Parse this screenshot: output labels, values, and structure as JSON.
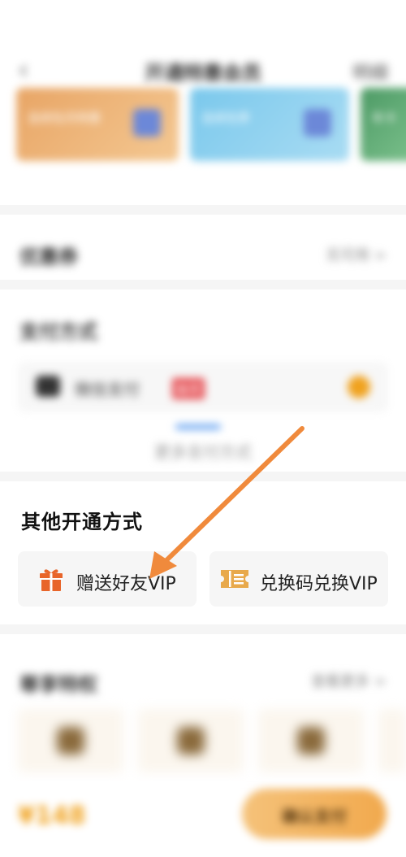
{
  "header": {
    "back_glyph": "‹",
    "title": "开通特惠会员",
    "right_label": "明细"
  },
  "plans": [
    {
      "text": "连续包月特惠"
    },
    {
      "text": "连续包季"
    },
    {
      "text": "年卡"
    }
  ],
  "coupon": {
    "label": "优惠券",
    "right_text": "无可用 >"
  },
  "payment": {
    "label": "支付方式",
    "method": "微信支付",
    "badge": "推荐",
    "more": "更多支付方式"
  },
  "other_methods": {
    "title": "其他开通方式",
    "gift_label": "赠送好友VIP",
    "redeem_label": "兑换码兑换VIP"
  },
  "privileges": {
    "label": "尊享特权",
    "right_text": "查看更多 >"
  },
  "bottom": {
    "price": "¥148",
    "button": "确认支付"
  },
  "colors": {
    "accent": "#f0a21e",
    "gift_icon": "#e8652a",
    "code_icon": "#e8a94b",
    "annotation_arrow": "#f08a3c"
  },
  "icons": [
    "back-icon",
    "gift-icon",
    "ticket-icon",
    "wechat-icon",
    "check-icon"
  ]
}
